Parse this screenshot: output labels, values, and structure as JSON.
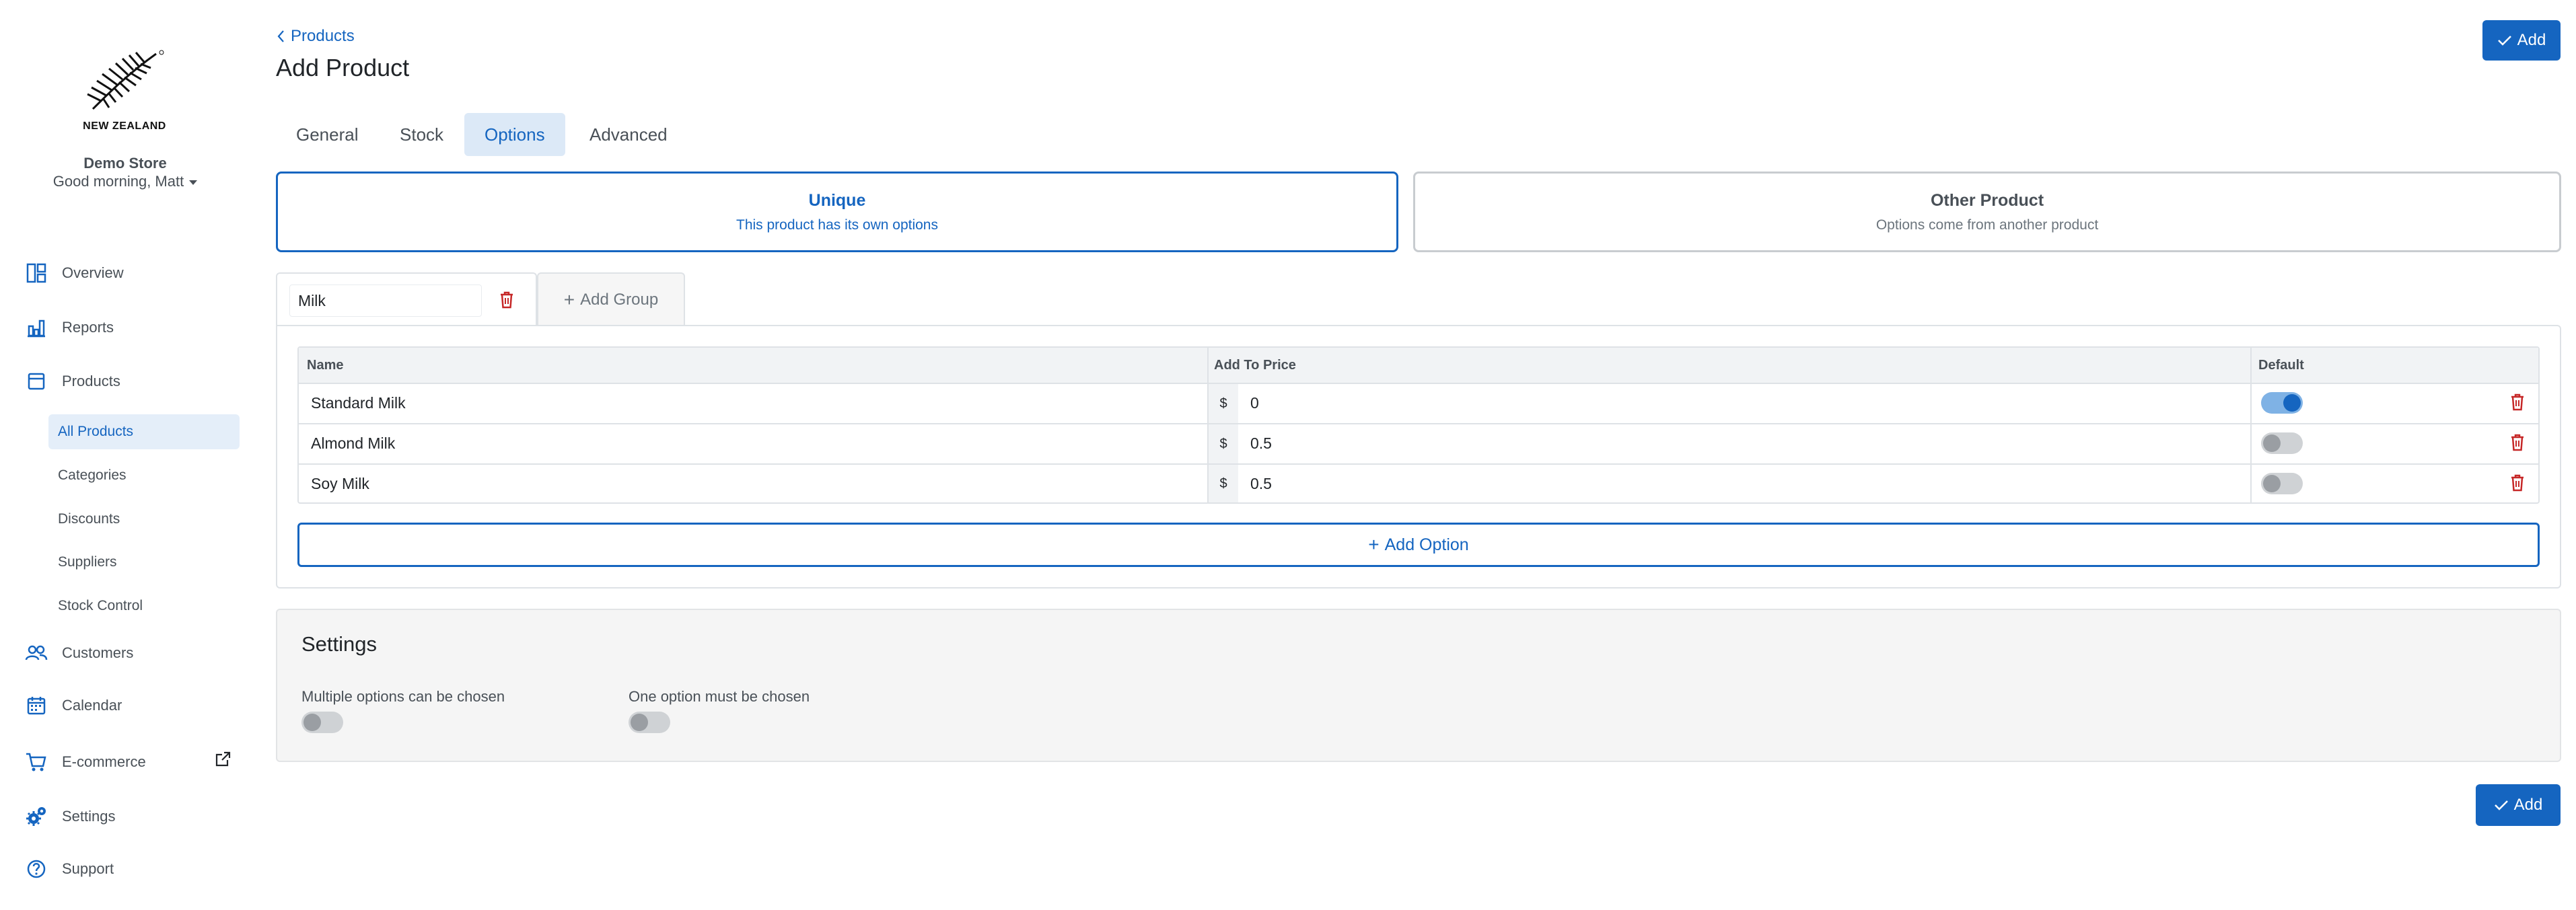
{
  "sidebar": {
    "logo_text": "NEW ZEALAND",
    "store_name": "Demo Store",
    "greeting": "Good morning, Matt",
    "nav": {
      "overview": "Overview",
      "reports": "Reports",
      "products": "Products",
      "customers": "Customers",
      "calendar": "Calendar",
      "ecommerce": "E-commerce",
      "settings": "Settings",
      "support": "Support"
    },
    "product_sub": {
      "all_products": "All Products",
      "categories": "Categories",
      "discounts": "Discounts",
      "suppliers": "Suppliers",
      "stock_control": "Stock Control"
    }
  },
  "header": {
    "breadcrumb": "Products",
    "title": "Add Product",
    "add_label": "Add"
  },
  "tabs": [
    "General",
    "Stock",
    "Options",
    "Advanced"
  ],
  "active_tab": "Options",
  "source_cards": {
    "unique": {
      "title": "Unique",
      "subtitle": "This product has its own options",
      "selected": true
    },
    "other": {
      "title": "Other Product",
      "subtitle": "Options come from another product",
      "selected": false
    }
  },
  "group": {
    "name": "Milk",
    "add_group_label": "Add Group"
  },
  "options_table": {
    "headers": {
      "name": "Name",
      "price": "Add To Price",
      "default": "Default"
    },
    "currency": "$",
    "rows": [
      {
        "name": "Standard Milk",
        "price": "0",
        "default": true
      },
      {
        "name": "Almond Milk",
        "price": "0.5",
        "default": false
      },
      {
        "name": "Soy Milk",
        "price": "0.5",
        "default": false
      }
    ],
    "add_option_label": "Add Option"
  },
  "settings": {
    "title": "Settings",
    "multiple_label": "Multiple options can be chosen",
    "multiple_on": false,
    "required_label": "One option must be chosen",
    "required_on": false
  },
  "footer": {
    "add_label": "Add"
  },
  "colors": {
    "primary": "#1565c0",
    "danger": "#c62828",
    "active_bg": "#e4eef9"
  }
}
